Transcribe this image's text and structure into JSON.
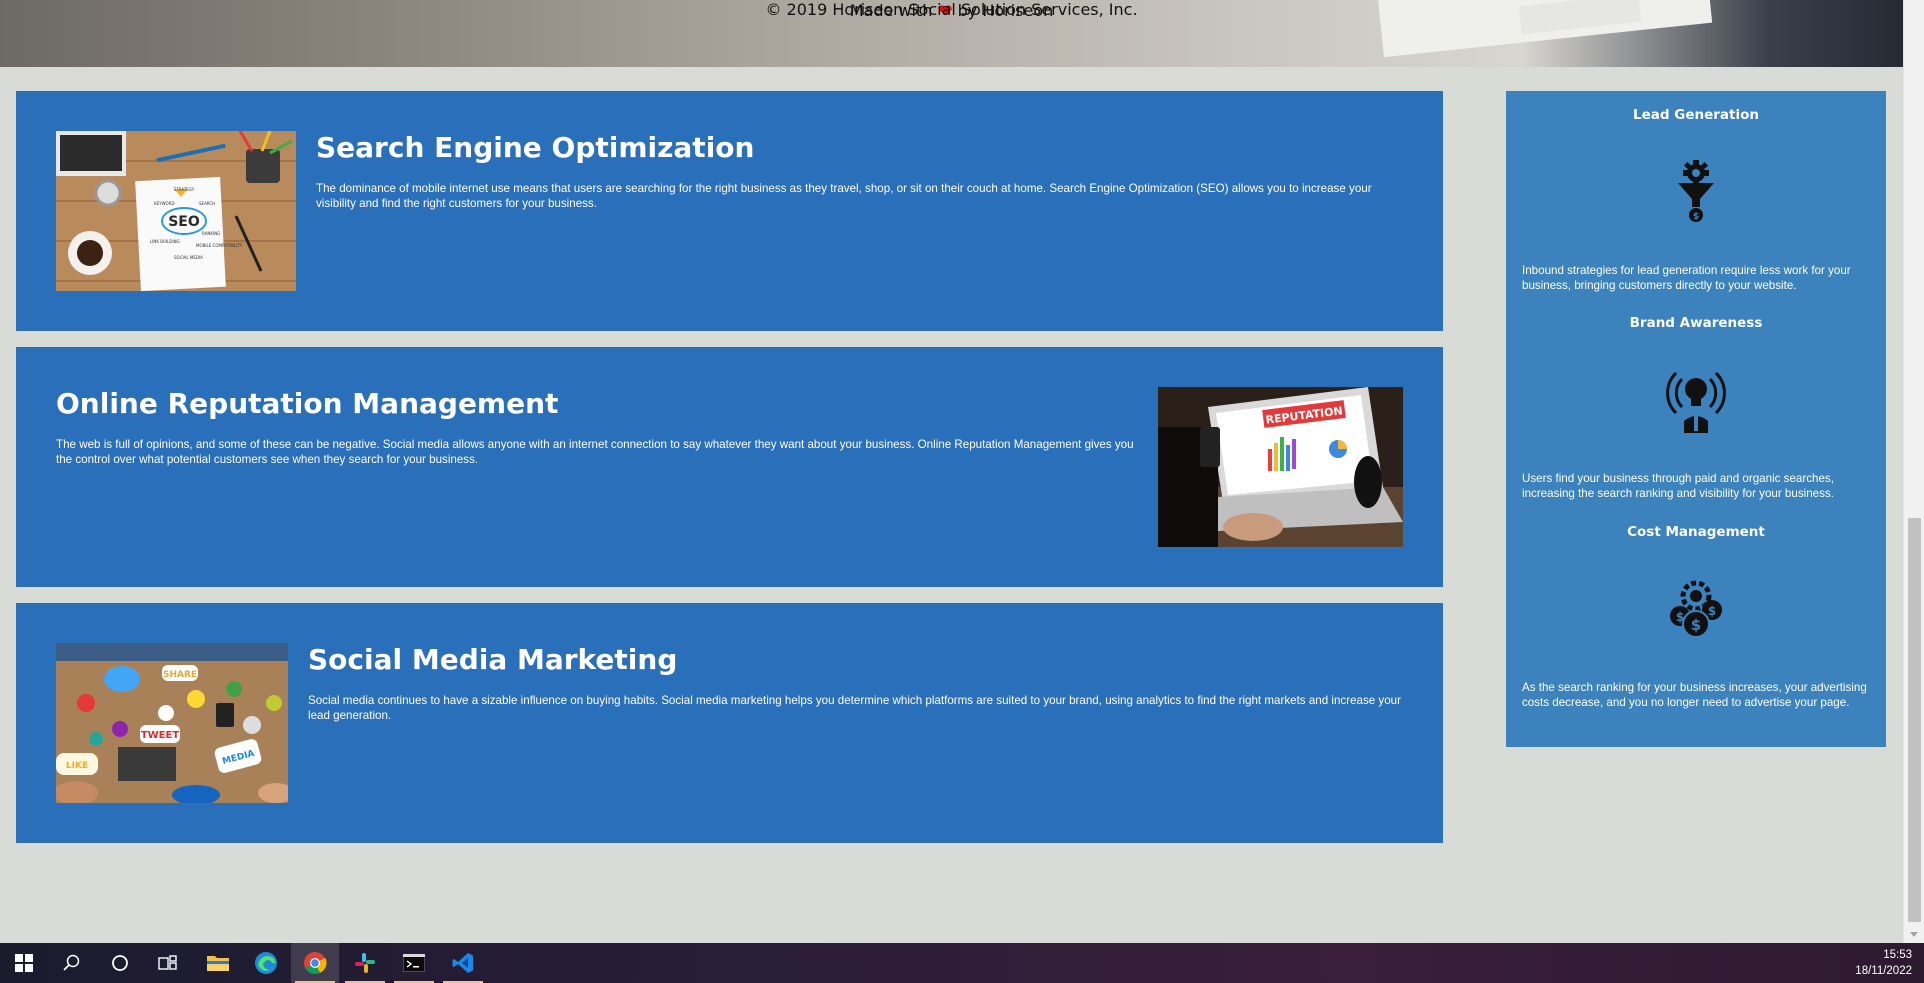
{
  "services": [
    {
      "title": "Search Engine Optimization",
      "body": "The dominance of mobile internet use means that users are searching for the right business as they travel, shop, or sit on their couch at home. Search Engine Optimization (SEO) allows you to increase your visibility and find the right customers for your business."
    },
    {
      "title": "Online Reputation Management",
      "body": "The web is full of opinions, and some of these can be negative. Social media allows anyone with an internet connection to say whatever they want about your business. Online Reputation Management gives you the control over what potential customers see when they search for your business."
    },
    {
      "title": "Social Media Marketing",
      "body": "Social media continues to have a sizable influence on buying habits. Social media marketing helps you determine which platforms are suited to your brand, using analytics to find the right markets and increase your lead generation."
    }
  ],
  "images": {
    "seo_words": [
      "SEO",
      "STRATEGY",
      "KEYWORD",
      "SEARCH",
      "LINK BUILDING",
      "RANKING",
      "MOBILE COMPATIBILITY",
      "SOCIAL MEDIA"
    ],
    "reputation_label": "REPUTATION",
    "social_words": [
      "SHARE",
      "TWEET",
      "LIKE",
      "MEDIA"
    ]
  },
  "benefits": [
    {
      "title": "Lead Generation",
      "icon": "lead-funnel-icon",
      "body": "Inbound strategies for lead generation require less work for your business, bringing customers directly to your website."
    },
    {
      "title": "Brand Awareness",
      "icon": "lightbulb-broadcast-icon",
      "body": "Users find your business through paid and organic searches, increasing the search ranking and visibility for your business."
    },
    {
      "title": "Cost Management",
      "icon": "gear-dollar-icon",
      "body": "As the search ranking for your business increases, your advertising costs decrease, and you no longer need to advertise your page."
    }
  ],
  "footer": {
    "made_prefix": "Made with",
    "heart": "❤",
    "made_suffix": "by Horiseon",
    "copyright": "© 2019 Horiseon Social Solution Services, Inc."
  },
  "taskbar": {
    "apps": [
      "windows-start",
      "search",
      "cortana",
      "task-view",
      "file-explorer",
      "edge",
      "chrome",
      "slack",
      "terminal",
      "vscode"
    ],
    "active_app": "chrome",
    "time": "15:53",
    "date": "18/11/2022"
  },
  "colors": {
    "card_blue": "#2a6fba",
    "sidebar_blue": "#3c82bd",
    "page_bg": "#d9dcd6",
    "heart": "#d51010"
  }
}
